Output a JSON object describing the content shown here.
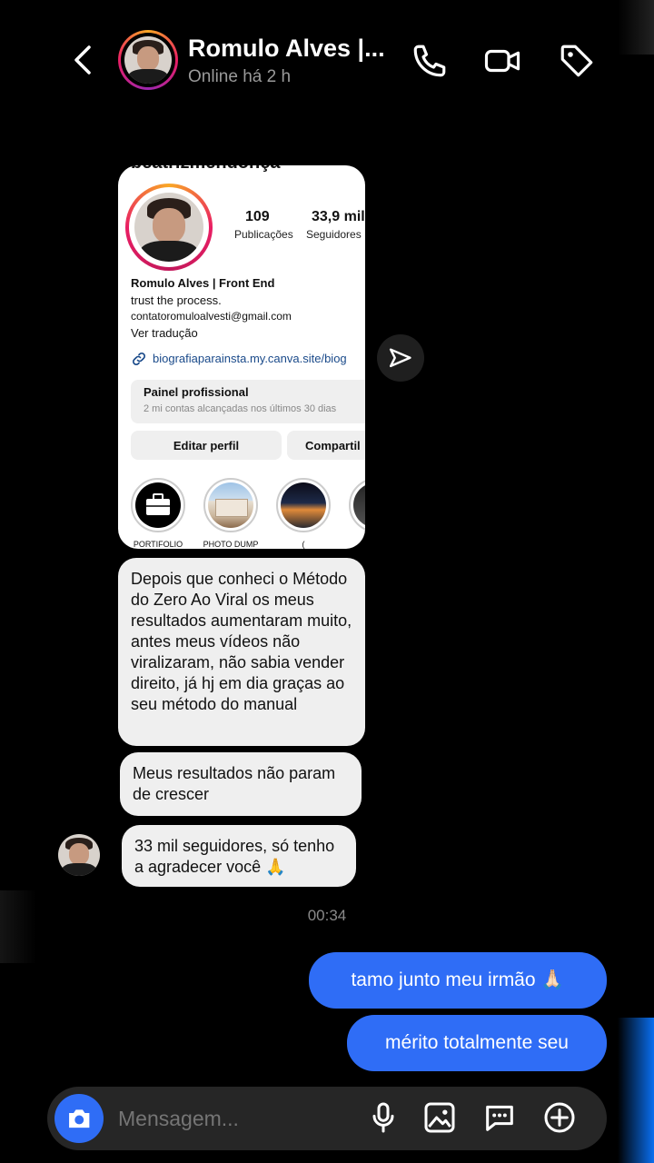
{
  "header": {
    "contact_name": "Romulo Alves |...",
    "status": "Online há 2 h",
    "icons": [
      "back-icon",
      "phone-icon",
      "video-call-icon",
      "tag-icon"
    ]
  },
  "shared_profile": {
    "username_cut": "beatrizmendonça",
    "posts_count": "109",
    "posts_label": "Publicações",
    "followers_count": "33,9 mil",
    "followers_label": "Seguidores",
    "display_name": "Romulo Alves | Front End",
    "bio": "trust the process.",
    "email": "contatoromuloalvesti@gmail.com",
    "translate": "Ver tradução",
    "link": "biografiaparainsta.my.canva.site/biog",
    "panel_title": "Painel profissional",
    "panel_sub": "2 mi contas alcançadas nos últimos 30 dias",
    "edit_button": "Editar perfil",
    "share_button": "Compartil",
    "highlights": [
      "PORTIFOLIO",
      "PHOTO DUMP",
      "(",
      ""
    ]
  },
  "messages_in": [
    "Depois que conheci o Método do Zero Ao Viral  os meus resultados aumentaram muito, antes meus vídeos não viralizaram, não sabia vender direito, já hj em dia graças ao seu método do manual",
    "Meus resultados não param de crescer",
    "33 mil seguidores, só tenho a agradecer você 🙏"
  ],
  "timestamp": "00:34",
  "messages_out": [
    "tamo junto meu irmão 🙏🏻",
    "mérito totalmente seu"
  ],
  "composer": {
    "placeholder": "Mensagem...",
    "icons": [
      "camera-icon",
      "microphone-icon",
      "gallery-icon",
      "sticker-icon",
      "plus-icon"
    ]
  },
  "colors": {
    "accent": "#2f6df6",
    "background": "#000000",
    "bubble_in": "#efefef"
  }
}
